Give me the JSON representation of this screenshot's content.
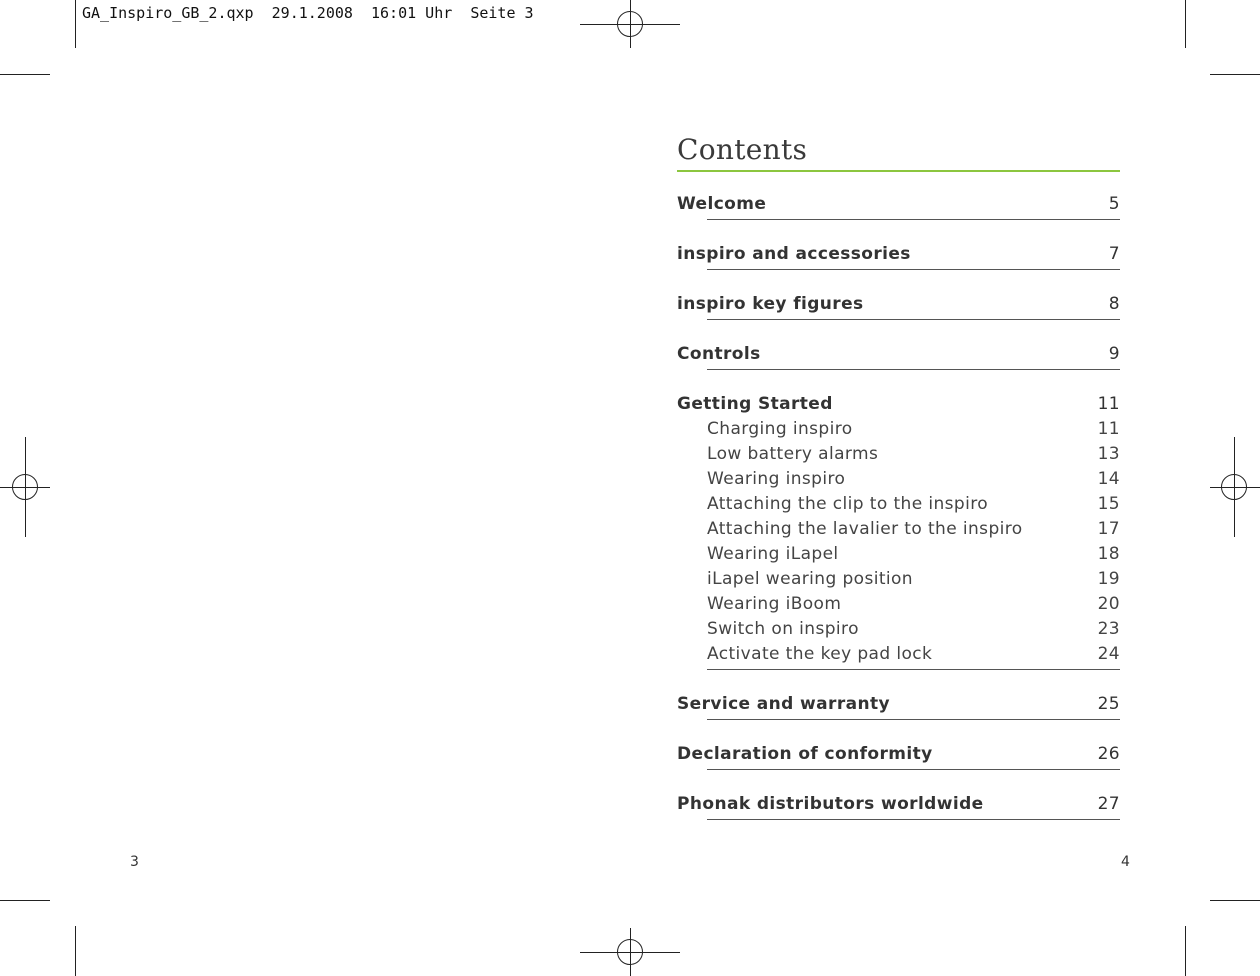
{
  "header": {
    "slug": "GA_Inspiro_GB_2.qxp  29.1.2008  16:01 Uhr  Seite 3"
  },
  "contents": {
    "title": "Contents",
    "accent_color": "#8cc63f",
    "entries": [
      {
        "label": "Welcome",
        "page": "5"
      },
      {
        "label": "inspiro and accessories",
        "page": "7"
      },
      {
        "label": "inspiro key figures",
        "page": "8"
      },
      {
        "label": "Controls",
        "page": "9"
      },
      {
        "label": "Getting Started",
        "page": "11"
      },
      {
        "label": "Charging inspiro",
        "page": "11"
      },
      {
        "label": "Low battery alarms",
        "page": "13"
      },
      {
        "label": "Wearing inspiro",
        "page": "14"
      },
      {
        "label": "Attaching the clip to the inspiro",
        "page": "15"
      },
      {
        "label": "Attaching the lavalier to the inspiro",
        "page": "17"
      },
      {
        "label": "Wearing iLapel",
        "page": "18"
      },
      {
        "label": "iLapel wearing position",
        "page": "19"
      },
      {
        "label": "Wearing iBoom",
        "page": "20"
      },
      {
        "label": "Switch on inspiro",
        "page": "23"
      },
      {
        "label": "Activate the key pad lock",
        "page": "24"
      },
      {
        "label": "Service and warranty",
        "page": "25"
      },
      {
        "label": "Declaration of conformity",
        "page": "26"
      },
      {
        "label": "Phonak distributors worldwide",
        "page": "27"
      }
    ]
  },
  "footer": {
    "left_page": "3",
    "right_page": "4"
  }
}
